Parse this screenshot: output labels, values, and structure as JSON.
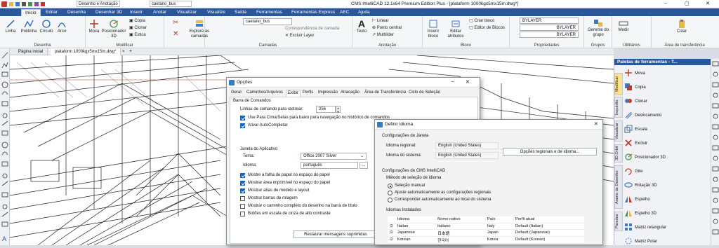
{
  "titlebar": {
    "title": "CMS IntelliCAD 12.1x64 Premium Edition Plus - [plataform 1000kgx5mx15m.dwg*]",
    "workspace": "Desenho e Anotação",
    "layer_box": "caetano_bus"
  },
  "ribbon_tabs": [
    "Início",
    "Editar",
    "Desenha",
    "Desenhar 3D",
    "Inserir",
    "Anotar",
    "Visualizar",
    "Visualize",
    "Saída",
    "Ferramentas",
    "Ferramentas Express",
    "AEC",
    "Ajuda"
  ],
  "ribbon": {
    "desenha": {
      "label": "Desenha",
      "buttons": [
        "Linha",
        "Polilinha",
        "Círculo",
        "Arco"
      ]
    },
    "modificar": {
      "label": "Modificar",
      "buttons": [
        "Mova",
        "Posicionador 3D"
      ],
      "small": [
        "Copia",
        "Clonar",
        "Estica"
      ]
    },
    "camadas": {
      "label": "Camadas",
      "explore": "Explore as camadas",
      "layer": "caetano_bus",
      "match": "Correspondência de camada",
      "exclude": "Excluir Layer"
    },
    "anotacao": {
      "label": "Anotação",
      "texto": "Texto",
      "items": [
        "Linear",
        "Ponto central",
        "Multilíder"
      ]
    },
    "bloco": {
      "label": "Bloco",
      "insert": "Inserir bloco",
      "edit": "Editar atributos",
      "create": "Criar bloco",
      "editor": "Editor de Blocos"
    },
    "propriedades": {
      "label": "Propriedades",
      "values": [
        "BYLAYER",
        "BYLAYER",
        "BYLAYER"
      ]
    },
    "grupos": {
      "label": "Grupos",
      "gerente": "Gerente do grupo"
    },
    "utilitarios": {
      "label": "Utilitários",
      "medir": "Medir"
    },
    "transferencia": {
      "label": "Área de transferência",
      "colar": "Colar"
    }
  },
  "doc_tabs": [
    "Página inicial",
    "plataform 1000kgx5mx15m.dwg*"
  ],
  "palette": {
    "title": "Paletas de ferramentas - T...",
    "vtabs": [
      "Modificar",
      "Inquérito",
      "Visualizar",
      "3D Orbit",
      "Arame de Desenho",
      "Paredes"
    ],
    "items": [
      "Mova",
      "Copia",
      "Clonar",
      "Deslocamento",
      "Escala",
      "Excluir",
      "Posicionador 3D",
      "Gire",
      "Rotação 3D",
      "Espelho",
      "Espelho 3D",
      "Matriz retangular",
      "Matriz Polar"
    ]
  },
  "options": {
    "title": "Opções",
    "tabs": [
      "Geral",
      "Caminhos/Arquivos",
      "Exibir",
      "Perfis",
      "Impressão",
      "Atracação",
      "Área de Transferência",
      "Ciclo de Seleção"
    ],
    "cmd_section": "Barra de Comandos",
    "lines_label": "Linhas de comando para rastrear:",
    "lines_value": "256",
    "chk1": "Use Para Cima/Setas para baixo para navegação no histórico de comandos",
    "chk2": "Ativar AutoCompletar",
    "app_section": "Janela do Aplicativo",
    "tema_label": "Tema:",
    "tema_value": "Office 2007 Silver",
    "idioma_label": "Idioma:",
    "idioma_value": "português",
    "checks": [
      "Mostre a folha de papel no espaço do papel",
      "Mostrar área imprimível no espaço do papel",
      "Mostrar abas de modelo e layout",
      "Mostrar barras de rolagem",
      "Mostrar o caminho completo do desenho na barra de título",
      "Botões em escala de cinza de alto contraste"
    ],
    "reset": "Restaurar mensagens suprimidas"
  },
  "language": {
    "title": "Definir Idioma",
    "win_section": "Configurações de Janela",
    "regional_label": "Idioma regional:",
    "regional_value": "English (United States)",
    "system_label": "Idioma do sistema:",
    "system_value": "English (United States)",
    "regional_btn": "Opções regionais e de idioma...",
    "cms_section": "Configurações de CMS IntelliCAD",
    "method_section": "Método de seleção de idioma",
    "radios": [
      "Seleção manual",
      "Ajuste automaticamente as configurações regionais",
      "Corresponder automaticamente ao local do sistema"
    ],
    "installed_section": "Idiomas Instalados",
    "columns": [
      "Idioma",
      "Nome nativo",
      "País",
      "Perfil atual"
    ],
    "rows": [
      [
        "Italian",
        "italiano",
        "Italy",
        "Default (Italian)"
      ],
      [
        "Japanese",
        "日本語",
        "Japan",
        "Default (Japanese)"
      ],
      [
        "Korean",
        "한국어",
        "Korea",
        "Default (Korean)"
      ]
    ]
  }
}
